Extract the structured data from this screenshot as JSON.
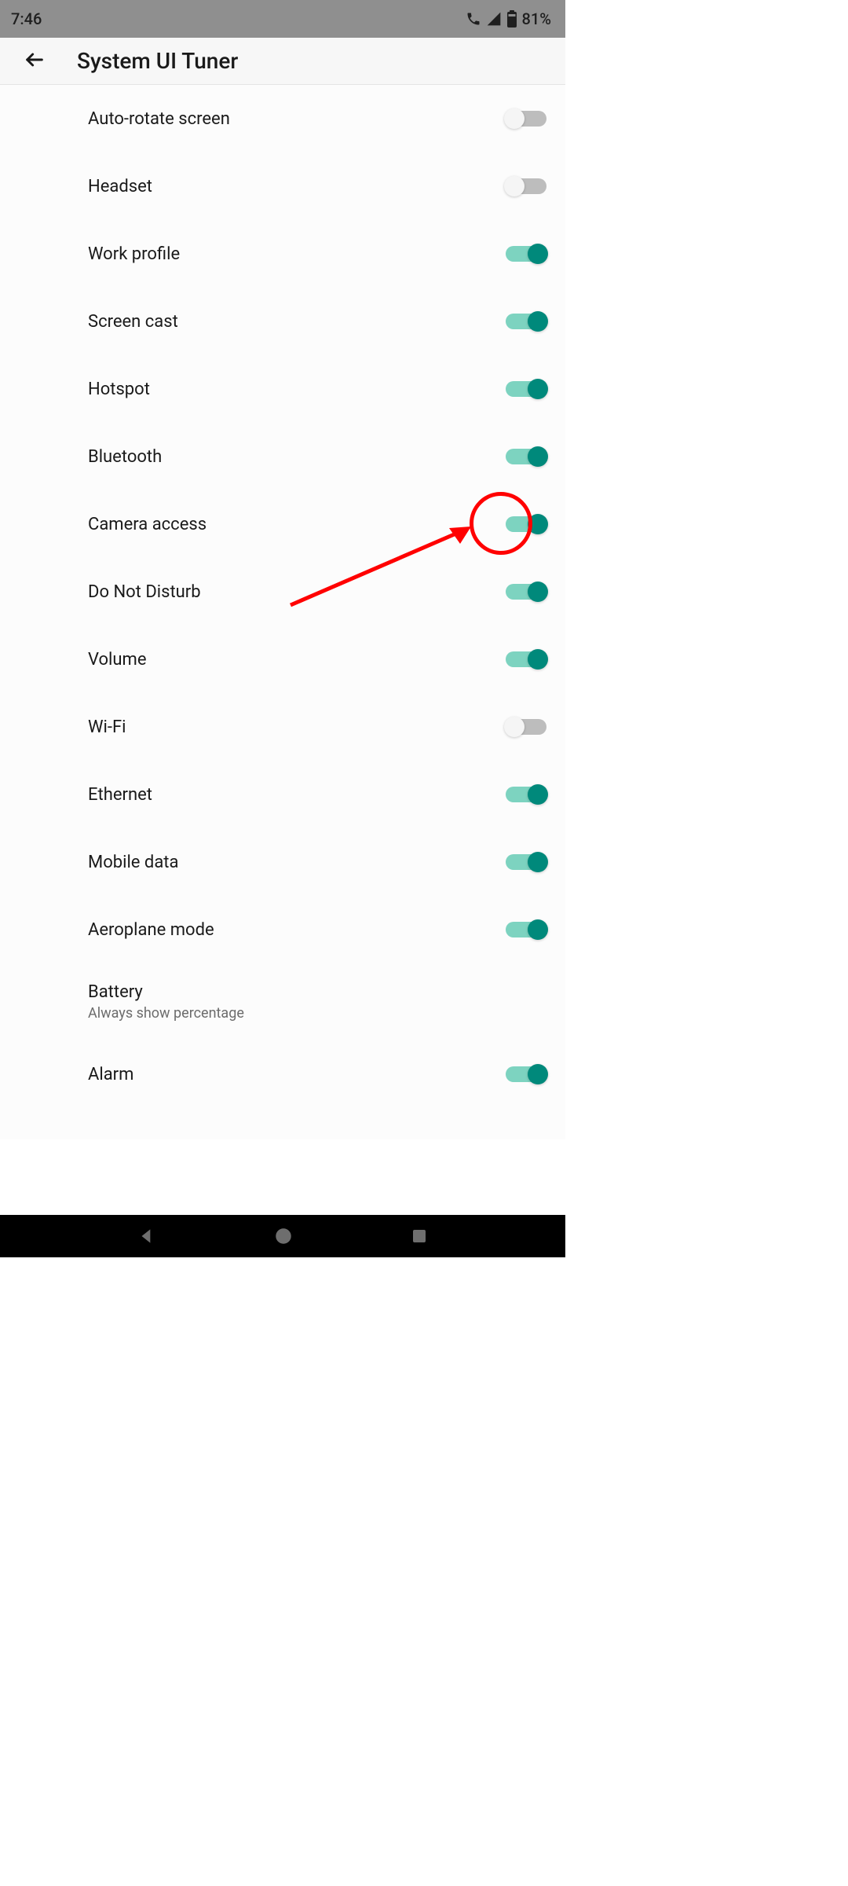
{
  "status": {
    "time": "7:46",
    "battery_pct": "81%"
  },
  "header": {
    "title": "System UI Tuner"
  },
  "items": [
    {
      "label": "Auto-rotate screen",
      "on": false
    },
    {
      "label": "Headset",
      "on": false
    },
    {
      "label": "Work profile",
      "on": true
    },
    {
      "label": "Screen cast",
      "on": true
    },
    {
      "label": "Hotspot",
      "on": true
    },
    {
      "label": "Bluetooth",
      "on": true
    },
    {
      "label": "Camera access",
      "on": true
    },
    {
      "label": "Do Not Disturb",
      "on": true
    },
    {
      "label": "Volume",
      "on": true
    },
    {
      "label": "Wi-Fi",
      "on": false,
      "highlighted": true
    },
    {
      "label": "Ethernet",
      "on": true
    },
    {
      "label": "Mobile data",
      "on": true
    },
    {
      "label": "Aeroplane mode",
      "on": true
    },
    {
      "label": "Battery",
      "sub": "Always show percentage"
    },
    {
      "label": "Alarm",
      "on": true
    }
  ],
  "colors": {
    "accent": "#00897b",
    "annotation": "#ff0000"
  }
}
